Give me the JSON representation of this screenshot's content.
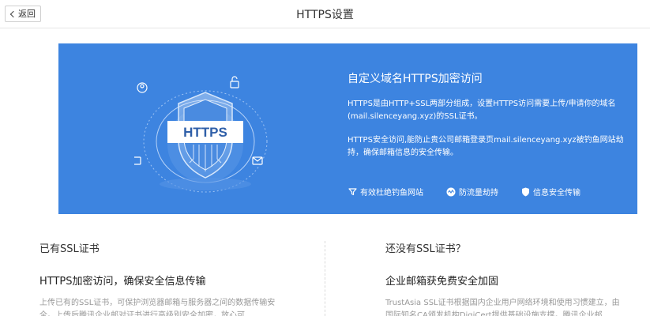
{
  "header": {
    "back_label": "返回",
    "title": "HTTPS设置"
  },
  "banner": {
    "badge_text": "HTTPS",
    "title": "自定义域名HTTPS加密访问",
    "paragraph1": "HTTPS是由HTTP+SSL两部分组成，设置HTTPS访问需要上传/申请你的域名(mail.silenceyang.xyz)的SSL证书。",
    "paragraph2": "HTTPS安全访问,能防止贵公司邮箱登录页mail.silenceyang.xyz被钓鱼网站劫持，确保邮箱信息的安全传输。",
    "features": [
      {
        "icon": "filter-icon",
        "label": "有效杜绝钓鱼网站"
      },
      {
        "icon": "activity-icon",
        "label": "防流量劫持"
      },
      {
        "icon": "shield-icon",
        "label": "信息安全传输"
      }
    ],
    "background_color": "#3d84e0"
  },
  "left_section": {
    "heading": "已有SSL证书",
    "subheading": "HTTPS加密访问，确保安全信息传输",
    "description": "上传已有的SSL证书，可保护浏览器邮箱与服务器之间的数据传输安全。上传后腾讯企业邮对证书进行高级别安全加密，放心可"
  },
  "right_section": {
    "heading": "还没有SSL证书？",
    "subheading": "企业邮箱获免费安全加固",
    "description": "TrustAsia SSL证书根据国内企业用户网络环境和使用习惯建立，由国际知名CA颁发机构DigiCert提供基础设施支撑。腾讯企业邮"
  }
}
